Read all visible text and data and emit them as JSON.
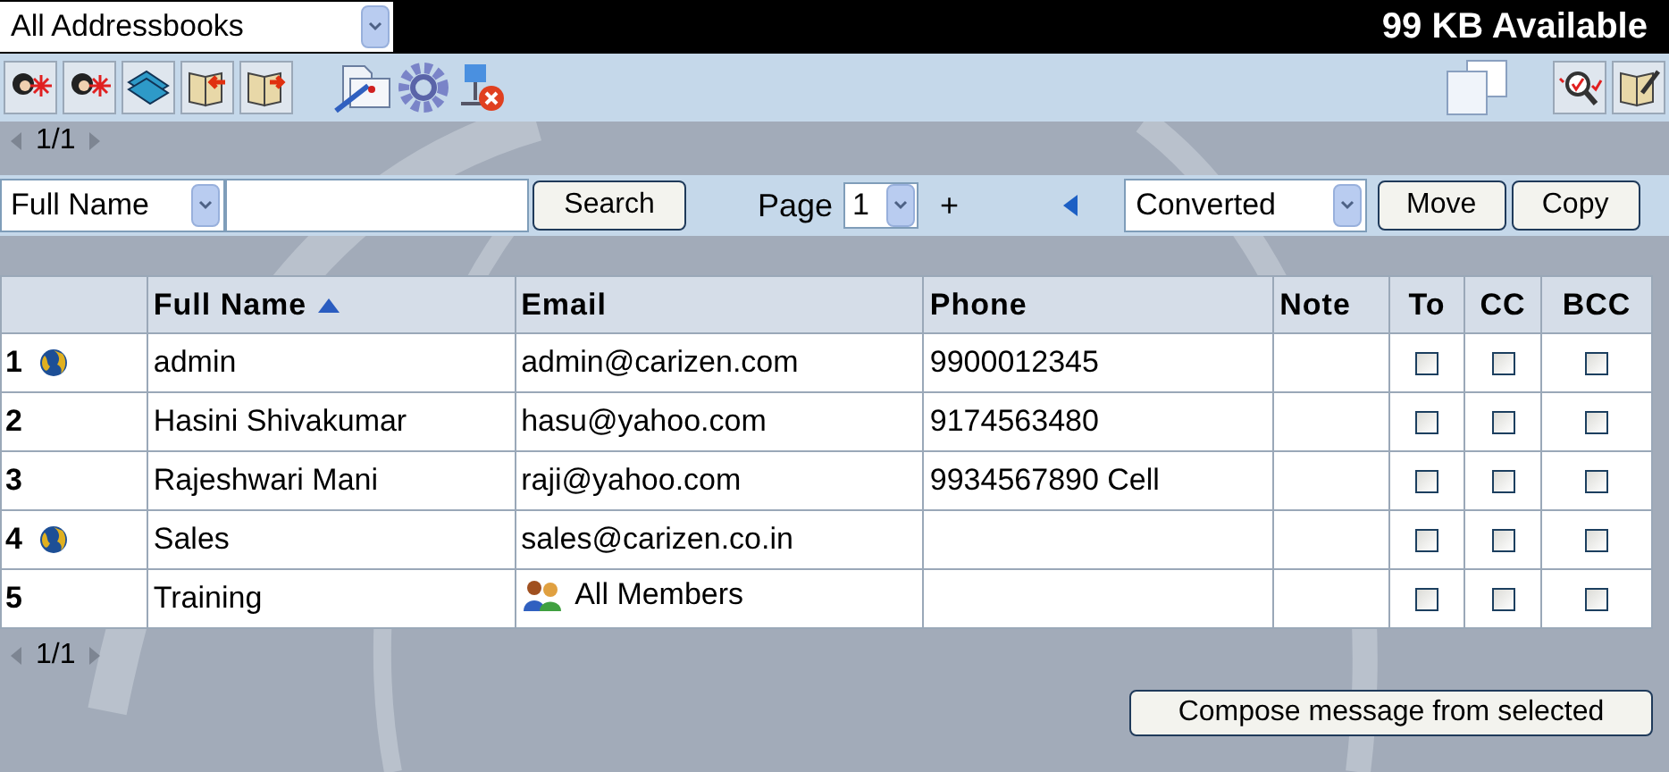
{
  "addressbook_select": {
    "value": "All Addressbooks"
  },
  "quota": "99 KB Available",
  "pager_top": {
    "text": "1/1"
  },
  "search": {
    "field": "Full Name",
    "button": "Search"
  },
  "page": {
    "label": "Page",
    "value": "1",
    "add": "+"
  },
  "folder_select": {
    "value": "Converted"
  },
  "move_button": "Move",
  "copy_button": "Copy",
  "table": {
    "columns": [
      {
        "label": "Full Name",
        "sorted": true
      },
      {
        "label": "Email",
        "sorted": false
      },
      {
        "label": "Phone",
        "sorted": false
      },
      {
        "label": "Note",
        "sorted": false
      },
      {
        "label": "To",
        "sorted": false
      },
      {
        "label": "CC",
        "sorted": false
      },
      {
        "label": "BCC",
        "sorted": false
      }
    ],
    "rows": [
      {
        "index": "1",
        "shared": true,
        "name": "admin",
        "kind": "contact",
        "email": "admin@carizen.com",
        "phone": "9900012345",
        "to": false,
        "cc": false,
        "bcc": false
      },
      {
        "index": "2",
        "shared": false,
        "name": "Hasini Shivakumar",
        "kind": "contact",
        "email": "hasu@yahoo.com",
        "phone": "9174563480",
        "to": false,
        "cc": false,
        "bcc": false
      },
      {
        "index": "3",
        "shared": false,
        "name": "Rajeshwari Mani",
        "kind": "contact",
        "email": "raji@yahoo.com",
        "phone": "9934567890 Cell",
        "to": false,
        "cc": false,
        "bcc": false
      },
      {
        "index": "4",
        "shared": true,
        "name": "Sales",
        "kind": "contact",
        "email": "sales@carizen.co.in",
        "to": false,
        "cc": false,
        "bcc": false
      },
      {
        "index": "5",
        "shared": false,
        "name": "Training",
        "kind": "group",
        "email": "All Members",
        "to": false,
        "cc": false,
        "bcc": false
      }
    ]
  },
  "pager_bottom": {
    "text": "1/1"
  },
  "compose_button": "Compose message from selected"
}
